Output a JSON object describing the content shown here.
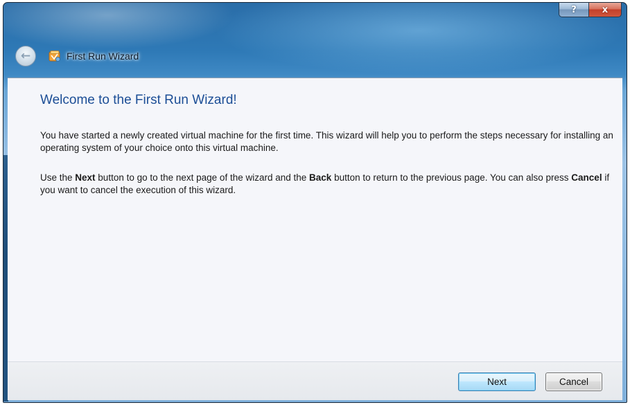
{
  "window": {
    "title": "First Run Wizard",
    "help_label": "?",
    "close_label": "x",
    "back_label": "←"
  },
  "content": {
    "heading": "Welcome to the First Run Wizard!",
    "paragraph1": "You have started a newly created virtual machine for the first time. This wizard will help you to perform the steps necessary for installing an operating system of your choice onto this virtual machine.",
    "paragraph2": {
      "t1": "Use the ",
      "b1": "Next",
      "t2": " button to go to the next page of the wizard and the ",
      "b2": "Back",
      "t3": " button to return to the previous page. You can also press ",
      "b3": "Cancel",
      "t4": " if you want to cancel the execution of this wizard."
    }
  },
  "buttons": {
    "next_label": "Next",
    "cancel_label": "Cancel"
  },
  "colors": {
    "heading": "#1c4e96",
    "title_bar": "#3f89c4",
    "close_button": "#c3402a",
    "default_button_border": "#3c7fb1"
  },
  "icons": {
    "back": "back-arrow-icon",
    "app": "virtualbox-app-icon",
    "help": "help-icon",
    "close": "close-icon"
  }
}
